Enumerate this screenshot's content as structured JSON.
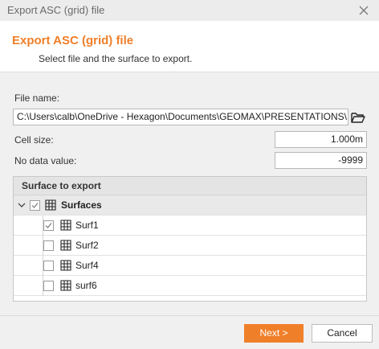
{
  "window": {
    "title": "Export ASC (grid) file"
  },
  "header": {
    "title": "Export ASC (grid) file",
    "subtitle": "Select file and the surface to export."
  },
  "form": {
    "file_name_label": "File name:",
    "file_name_value": "C:\\Users\\calb\\OneDrive - Hexagon\\Documents\\GEOMAX\\PRESENTATIONS\\",
    "cell_size_label": "Cell size:",
    "cell_size_value": "1.000m",
    "no_data_label": "No data value:",
    "no_data_value": "-9999"
  },
  "surfaces": {
    "group_label": "Surface to export",
    "parent": {
      "label": "Surfaces",
      "checked": true,
      "expanded": true
    },
    "items": [
      {
        "label": "Surf1",
        "checked": true
      },
      {
        "label": "Surf2",
        "checked": false
      },
      {
        "label": "Surf4",
        "checked": false
      },
      {
        "label": "surf6",
        "checked": false
      }
    ]
  },
  "footer": {
    "next_label": "Next >",
    "cancel_label": "Cancel"
  },
  "colors": {
    "accent": "#f07f29"
  },
  "icons": {
    "close": "close-icon",
    "folder": "folder-open-icon",
    "grid": "grid-icon",
    "chevron": "chevron-down-icon",
    "check": "checkmark-icon"
  }
}
